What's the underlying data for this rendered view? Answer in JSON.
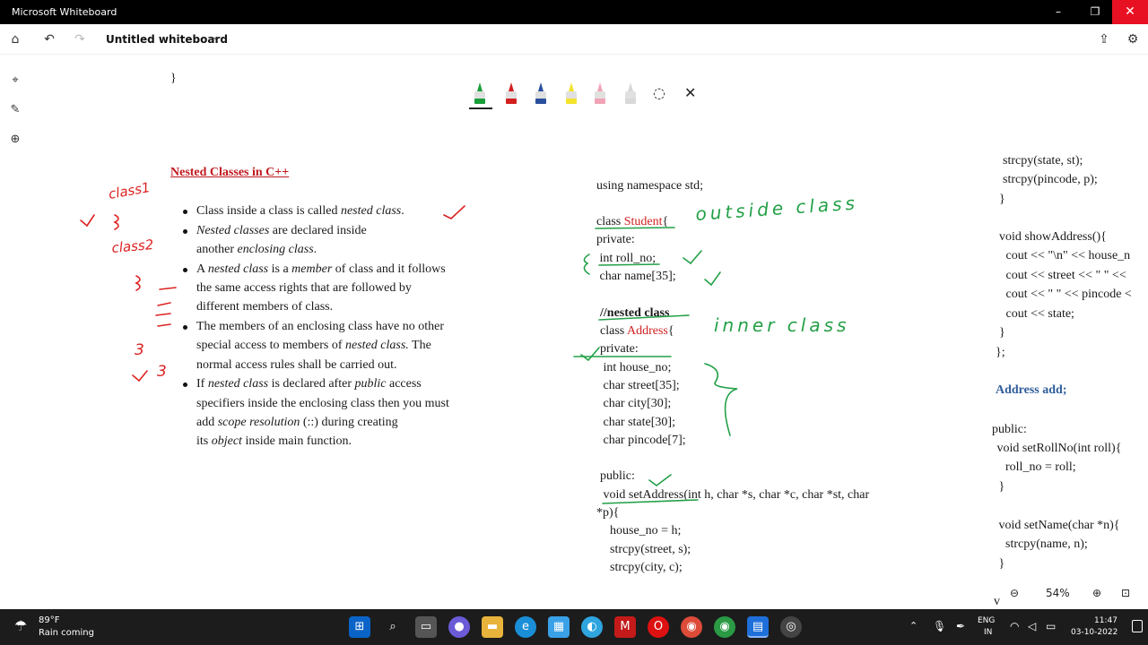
{
  "window": {
    "title": "Microsoft Whiteboard",
    "minimize_glyph": "–",
    "maximize_glyph": "❐",
    "close_glyph": "✕"
  },
  "toolbar": {
    "doc_title": "Untitled whiteboard",
    "home_icon": "⌂",
    "undo_icon": "↶",
    "redo_icon": "↷",
    "share_icon": "⇪",
    "settings_icon": "⚙",
    "chevron": "⌄"
  },
  "left_rail": {
    "select_icon": "⌖",
    "ink_icon": "✎",
    "add_icon": "⊕"
  },
  "ink_toolbar": {
    "pens": [
      {
        "name": "green-pen",
        "color": "#1a9e3a"
      },
      {
        "name": "red-pen",
        "color": "#d41f1f"
      },
      {
        "name": "blue-pen",
        "color": "#2a4f9e"
      },
      {
        "name": "yellow-highlighter",
        "color": "#f3e32a"
      },
      {
        "name": "pink-highlighter",
        "color": "#f2a3b5"
      },
      {
        "name": "eraser",
        "color": "#d8d8d8"
      }
    ],
    "lasso_icon": "◌",
    "close_icon": "✕"
  },
  "left_slide": {
    "stray_brace": "}",
    "heading": "Nested Classes in C++",
    "bullets": [
      [
        {
          "t": "Class inside a class is called "
        },
        {
          "t": "nested class",
          "i": true
        },
        {
          "t": "."
        }
      ],
      [
        {
          "t": "Nested classes",
          "i": true
        },
        {
          "t": " are declared inside"
        }
      ],
      [
        {
          "t": "another "
        },
        {
          "t": "enclosing class",
          "i": true
        },
        {
          "t": "."
        }
      ],
      [
        {
          "t": "A "
        },
        {
          "t": "nested class",
          "i": true
        },
        {
          "t": " is a "
        },
        {
          "t": "member",
          "i": true
        },
        {
          "t": " of class and it follows"
        }
      ],
      [
        {
          "t": "the same access rights that are followed by"
        }
      ],
      [
        {
          "t": "different members of class."
        }
      ],
      [
        {
          "t": "The members of an enclosing class have no other"
        }
      ],
      [
        {
          "t": "special access to members of "
        },
        {
          "t": "nested class.",
          "i": true
        },
        {
          "t": " The"
        }
      ],
      [
        {
          "t": "normal access rules shall be carried out."
        }
      ],
      [
        {
          "t": "If "
        },
        {
          "t": "nested class",
          "i": true
        },
        {
          "t": " is declared after "
        },
        {
          "t": "public",
          "i": true
        },
        {
          "t": " access"
        }
      ],
      [
        {
          "t": "specifiers inside the enclosing class then you must"
        }
      ],
      [
        {
          "t": "add "
        },
        {
          "t": "scope resolution",
          "i": true
        },
        {
          "t": " (::) during creating"
        }
      ],
      [
        {
          "t": "its "
        },
        {
          "t": "object",
          "i": true
        },
        {
          "t": " inside main function."
        }
      ]
    ]
  },
  "center_code": {
    "lines": [
      [
        {
          "t": "using namespace std;"
        }
      ],
      [
        {
          "t": "class "
        },
        {
          "t": "Student",
          "c": "red"
        },
        {
          "t": "{"
        }
      ],
      [
        {
          "t": "private:"
        }
      ],
      [
        {
          "t": " int roll_no;"
        }
      ],
      [
        {
          "t": " char name[35];"
        }
      ],
      [
        {
          "t": "//nested class",
          "b": true
        }
      ],
      [
        {
          "t": "class "
        },
        {
          "t": "Address",
          "c": "red"
        },
        {
          "t": "{"
        }
      ],
      [
        {
          "t": "private:"
        }
      ],
      [
        {
          "t": " int house_no;"
        }
      ],
      [
        {
          "t": " char street[35];"
        }
      ],
      [
        {
          "t": " char city[30];"
        }
      ],
      [
        {
          "t": " char state[30];"
        }
      ],
      [
        {
          "t": " char pincode[7];"
        }
      ],
      [
        {
          "t": "public:"
        }
      ],
      [
        {
          "t": " void setAddress(int h, char *s, char *c, char *st, char"
        }
      ],
      [
        {
          "t": "*p){"
        }
      ],
      [
        {
          "t": "  house_no = h;"
        }
      ],
      [
        {
          "t": "  strcpy(street, s);"
        }
      ],
      [
        {
          "t": "  strcpy(city, c);"
        }
      ]
    ]
  },
  "right_code": {
    "lines": [
      [
        {
          "t": "strcpy(state, st);"
        }
      ],
      [
        {
          "t": "strcpy(pincode, p);"
        }
      ],
      [
        {
          "t": "}"
        }
      ],
      [
        {
          "t": "void showAddress(){"
        }
      ],
      [
        {
          "t": " cout << \"\\n\" << house_n"
        }
      ],
      [
        {
          "t": " cout << street << \" \" <<"
        }
      ],
      [
        {
          "t": " cout << \" \" << pincode <"
        }
      ],
      [
        {
          "t": " cout << state;"
        }
      ],
      [
        {
          "t": "}"
        }
      ],
      [
        {
          "t": "};"
        }
      ],
      [
        {
          "t": "Address add;",
          "b": true,
          "c": "blue"
        }
      ],
      [
        {
          "t": "public:"
        }
      ],
      [
        {
          "t": " void setRollNo(int roll){"
        }
      ],
      [
        {
          "t": "  roll_no = roll;"
        }
      ],
      [
        {
          "t": " }"
        }
      ],
      [
        {
          "t": " void setName(char *n){"
        }
      ],
      [
        {
          "t": "  strcpy(name, n);"
        }
      ],
      [
        {
          "t": " }"
        }
      ],
      [
        {
          "t": "v"
        }
      ]
    ]
  },
  "handwriting": {
    "class1": "class1",
    "class2": "class2",
    "outside": "outside class",
    "inner": "inner class",
    "three_1": "3",
    "three_2": "3"
  },
  "zoom": {
    "zoom_out_icon": "⊖",
    "level": "54%",
    "zoom_in_icon": "⊕",
    "fit_icon": "⊡"
  },
  "taskbar": {
    "weather_temp": "89°F",
    "weather_desc": "Rain coming",
    "language": "ENG",
    "region": "IN",
    "time": "11:47",
    "date": "03-10-2022"
  }
}
